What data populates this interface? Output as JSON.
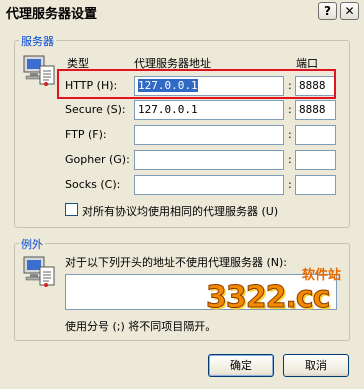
{
  "window": {
    "title": "代理服务器设置",
    "help_label": "?",
    "close_label": "✕"
  },
  "servers": {
    "group_label": "服务器",
    "col_type": "类型",
    "col_address": "代理服务器地址",
    "col_port": "端口",
    "rows": [
      {
        "label": "HTTP (H):",
        "address": "127.0.0.1",
        "port": "8888"
      },
      {
        "label": "Secure (S):",
        "address": "127.0.0.1",
        "port": "8888"
      },
      {
        "label": "FTP (F):",
        "address": "",
        "port": ""
      },
      {
        "label": "Gopher (G):",
        "address": "",
        "port": ""
      },
      {
        "label": "Socks (C):",
        "address": "",
        "port": ""
      }
    ],
    "same_for_all_label": "对所有协议均使用相同的代理服务器 (U)"
  },
  "exceptions": {
    "group_label": "例外",
    "description": "对于以下列开头的地址不使用代理服务器 (N):",
    "value": "",
    "hint": "使用分号 (;) 将不同项目隔开。"
  },
  "watermark": {
    "brand": "3322.cc",
    "tag": "软件站"
  },
  "buttons": {
    "ok": "确定",
    "cancel": "取消"
  },
  "colors": {
    "highlight_box": "#e0141e",
    "group_label": "#0046d5",
    "dialog_bg": "#ece9d8"
  }
}
